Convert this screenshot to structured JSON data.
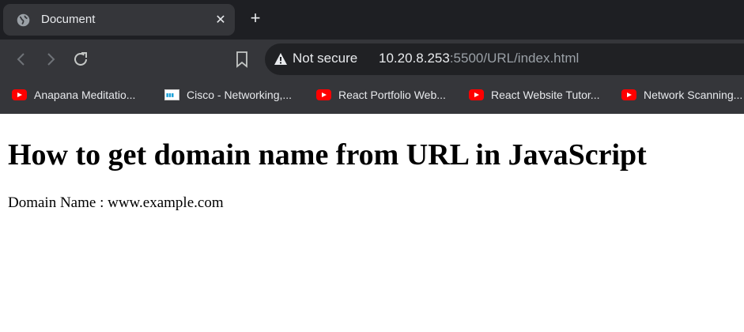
{
  "browser": {
    "tab": {
      "title": "Document"
    },
    "address_bar": {
      "security_label": "Not secure",
      "url_host": "10.20.8.253",
      "url_rest": ":5500/URL/index.html"
    },
    "bookmarks": [
      {
        "label": "Anapana Meditatio...",
        "icon": "youtube-icon"
      },
      {
        "label": "Cisco - Networking,...",
        "icon": "cisco-icon"
      },
      {
        "label": "React Portfolio Web...",
        "icon": "youtube-icon"
      },
      {
        "label": "React Website Tutor...",
        "icon": "youtube-icon"
      },
      {
        "label": "Network Scanning...",
        "icon": "youtube-icon"
      }
    ]
  },
  "page": {
    "heading": "How to get domain name from URL in JavaScript",
    "domain_text": "Domain Name : www.example.com"
  },
  "colors": {
    "tabstrip": "#1e1f23",
    "toolbar": "#35363a",
    "omnibox": "#202124",
    "youtube_red": "#ff0000"
  }
}
